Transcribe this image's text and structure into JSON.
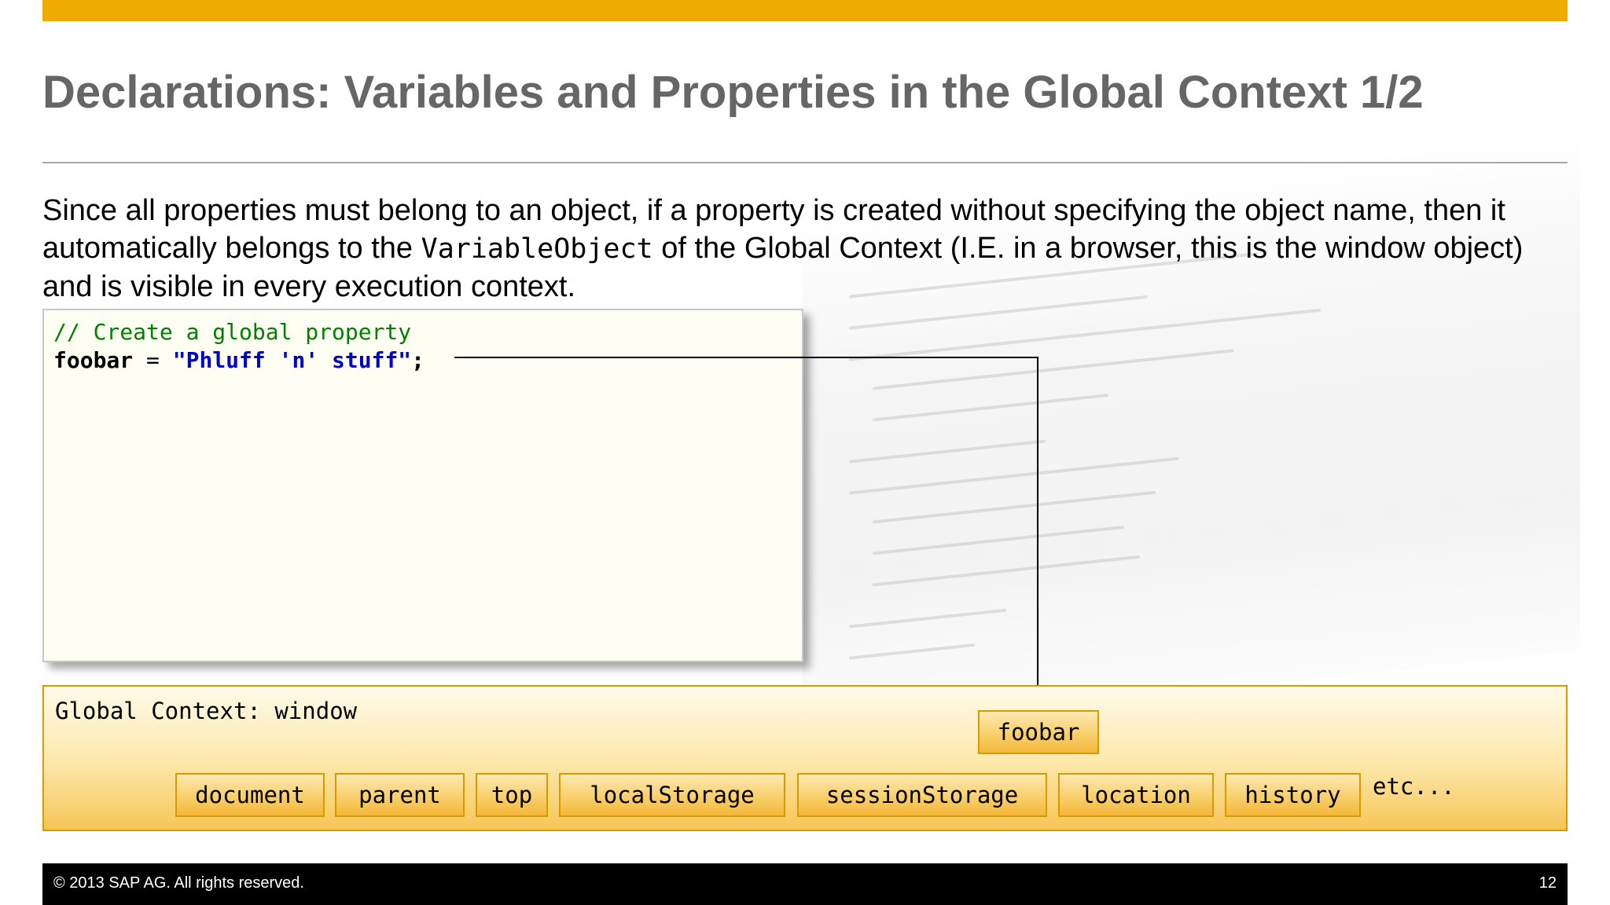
{
  "slide": {
    "title": "Declarations: Variables and Properties in the Global Context 1/2",
    "body": {
      "part1": "Since all properties must belong to an object, if a property is created without specifying the object name, then it automatically belongs to the ",
      "mono": "VariableObject",
      "part2": " of the Global Context (I.E. in a browser, this is the window object) and is visible in every execution context."
    },
    "code": {
      "comment": "// Create a global property",
      "ident": "foobar",
      "op": " = ",
      "string": "\"Phluff 'n' stuff\"",
      "punct": ";"
    },
    "global_context": {
      "label": "Global Context: window",
      "new_property": "foobar",
      "properties": [
        "document",
        "parent",
        "top",
        "localStorage",
        "sessionStorage",
        "location",
        "history"
      ],
      "etc": "etc..."
    },
    "footer": {
      "copyright": "© 2013 SAP AG. All rights reserved.",
      "page_number": "12"
    },
    "colors": {
      "accent_bar": "#f0ab00",
      "title_text": "#666666",
      "code_comment": "#008000",
      "code_string": "#0000cc",
      "context_border": "#d79a00"
    }
  }
}
